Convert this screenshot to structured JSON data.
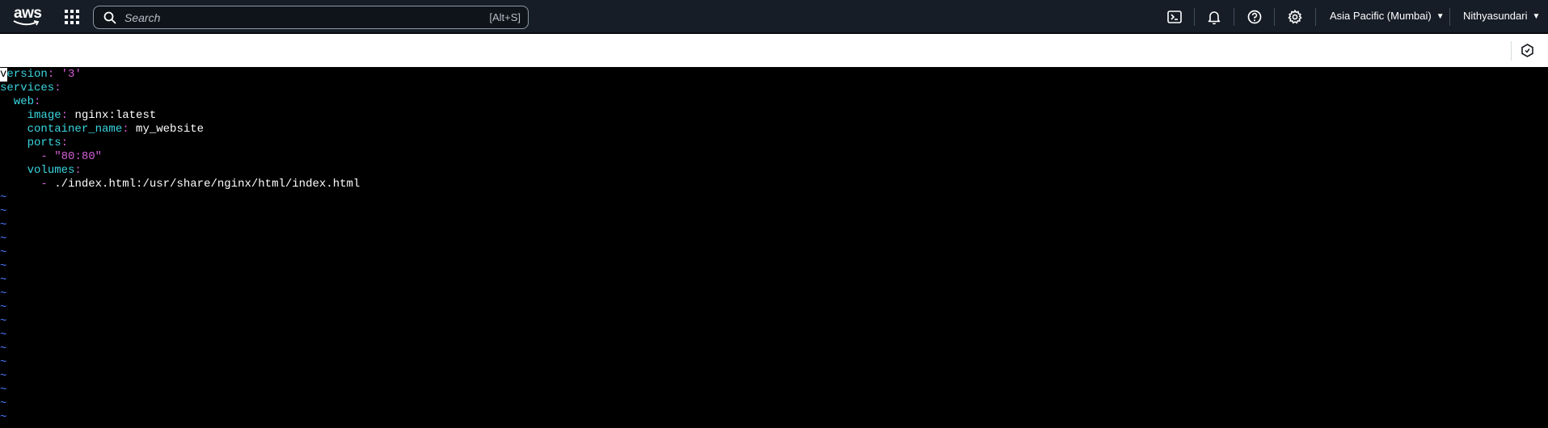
{
  "topnav": {
    "logo_text": "aws",
    "search_placeholder": "Search",
    "search_shortcut": "[Alt+S]",
    "region": "Asia Pacific (Mumbai)",
    "account": "Nithyasundari"
  },
  "icons": {
    "apps": "grid-icon",
    "search": "search-icon",
    "cloudshell": "terminal-icon",
    "notifications": "bell-icon",
    "help": "help-icon",
    "settings": "gear-icon",
    "subbar_action": "hexagon-icon"
  },
  "colors": {
    "nav_bg": "#161d26",
    "yaml_key": "#3ad6e0",
    "yaml_punct": "#d65fd6",
    "vim_tilde": "#4d79ff"
  },
  "editor": {
    "lines": [
      {
        "indent": "",
        "first": "v",
        "key": "ersion",
        "punct": ": ",
        "value": "",
        "string": "'3'"
      },
      {
        "indent": "",
        "first": "",
        "key": "services",
        "punct": ":",
        "value": "",
        "string": ""
      },
      {
        "indent": "  ",
        "first": "",
        "key": "web",
        "punct": ":",
        "value": "",
        "string": ""
      },
      {
        "indent": "    ",
        "first": "",
        "key": "image",
        "punct": ": ",
        "value": "nginx:latest",
        "string": ""
      },
      {
        "indent": "    ",
        "first": "",
        "key": "container_name",
        "punct": ": ",
        "value": "my_website",
        "string": ""
      },
      {
        "indent": "    ",
        "first": "",
        "key": "ports",
        "punct": ":",
        "value": "",
        "string": ""
      },
      {
        "indent": "      ",
        "first": "",
        "key": "",
        "punct": "- ",
        "value": "",
        "string": "\"80:80\""
      },
      {
        "indent": "    ",
        "first": "",
        "key": "volumes",
        "punct": ":",
        "value": "",
        "string": ""
      },
      {
        "indent": "      ",
        "first": "",
        "key": "",
        "punct": "- ",
        "value": "./index.html:/usr/share/nginx/html/index.html",
        "string": ""
      }
    ],
    "tilde": "~",
    "tilde_count": 17
  }
}
